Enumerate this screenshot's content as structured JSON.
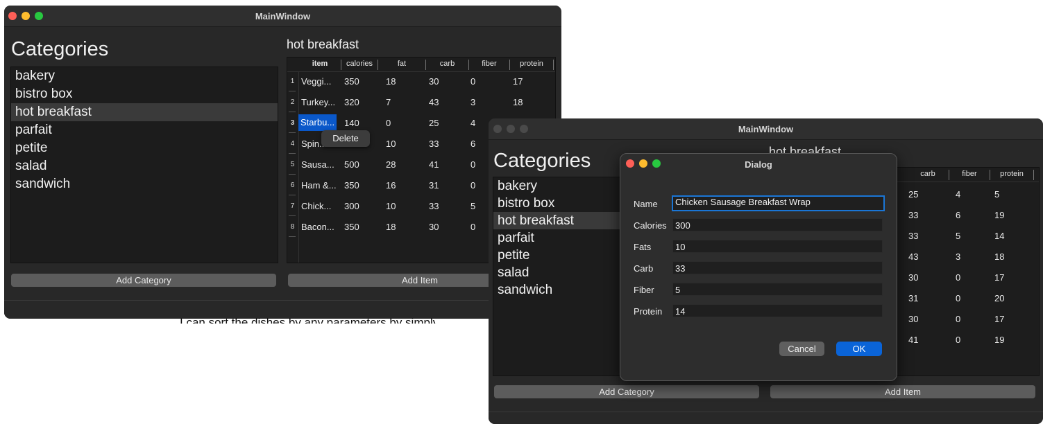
{
  "window1": {
    "title": "MainWindow",
    "categories_heading": "Categories",
    "categories": [
      "bakery",
      "bistro box",
      "hot breakfast",
      "parfait",
      "petite",
      "salad",
      "sandwich"
    ],
    "selected_category": "hot breakfast",
    "table_title": "hot breakfast",
    "columns": [
      "item",
      "calories",
      "fat",
      "carb",
      "fiber",
      "protein"
    ],
    "rows": [
      {
        "num": "1",
        "item": "Veggi...",
        "calories": "350",
        "fat": "18",
        "carb": "30",
        "fiber": "0",
        "protein": "17"
      },
      {
        "num": "2",
        "item": "Turkey...",
        "calories": "320",
        "fat": "7",
        "carb": "43",
        "fiber": "3",
        "protein": "18"
      },
      {
        "num": "3",
        "item": "Starbu...",
        "calories": "140",
        "fat": "0",
        "carb": "25",
        "fiber": "4",
        "protein": ""
      },
      {
        "num": "4",
        "item": "Spin...",
        "calories": "",
        "fat": "10",
        "carb": "33",
        "fiber": "6",
        "protein": ""
      },
      {
        "num": "5",
        "item": "Sausa...",
        "calories": "500",
        "fat": "28",
        "carb": "41",
        "fiber": "0",
        "protein": ""
      },
      {
        "num": "6",
        "item": "Ham &...",
        "calories": "350",
        "fat": "16",
        "carb": "31",
        "fiber": "0",
        "protein": ""
      },
      {
        "num": "7",
        "item": "Chick...",
        "calories": "300",
        "fat": "10",
        "carb": "33",
        "fiber": "5",
        "protein": ""
      },
      {
        "num": "8",
        "item": "Bacon...",
        "calories": "350",
        "fat": "18",
        "carb": "30",
        "fiber": "0",
        "protein": ""
      }
    ],
    "context_menu_item": "Delete",
    "add_category_label": "Add Category",
    "add_item_label": "Add Item"
  },
  "background_text": "I can sort the dishes by any parameters by simply clicking on the column at",
  "window2": {
    "title": "MainWindow",
    "categories_heading": "Categories",
    "categories": [
      "bakery",
      "bistro box",
      "hot breakfast",
      "parfait",
      "petite",
      "salad",
      "sandwich"
    ],
    "selected_category": "hot breakfast",
    "table_title_partial": "hot breakfast",
    "columns_visible": [
      "carb",
      "fiber",
      "protein"
    ],
    "rows_visible": [
      {
        "carb": "25",
        "fiber": "4",
        "protein": "5"
      },
      {
        "carb": "33",
        "fiber": "6",
        "protein": "19"
      },
      {
        "carb": "33",
        "fiber": "5",
        "protein": "14"
      },
      {
        "carb": "43",
        "fiber": "3",
        "protein": "18"
      },
      {
        "carb": "30",
        "fiber": "0",
        "protein": "17"
      },
      {
        "carb": "31",
        "fiber": "0",
        "protein": "20"
      },
      {
        "carb": "30",
        "fiber": "0",
        "protein": "17"
      },
      {
        "carb": "41",
        "fiber": "0",
        "protein": "19"
      }
    ],
    "add_category_label": "Add Category",
    "add_item_label": "Add Item"
  },
  "dialog": {
    "title": "Dialog",
    "fields": [
      {
        "label": "Name",
        "value": "Chicken Sausage Breakfast Wrap"
      },
      {
        "label": "Calories",
        "value": "300"
      },
      {
        "label": "Fats",
        "value": "10"
      },
      {
        "label": "Carb",
        "value": "33"
      },
      {
        "label": "Fiber",
        "value": "5"
      },
      {
        "label": "Protein",
        "value": "14"
      }
    ],
    "cancel_label": "Cancel",
    "ok_label": "OK"
  },
  "colors": {
    "window_bg": "#282828",
    "list_bg": "#1c1c1c",
    "selection": "#0a58ca",
    "ok_button": "#0a64d8",
    "focus_ring": "#1a76d6"
  }
}
